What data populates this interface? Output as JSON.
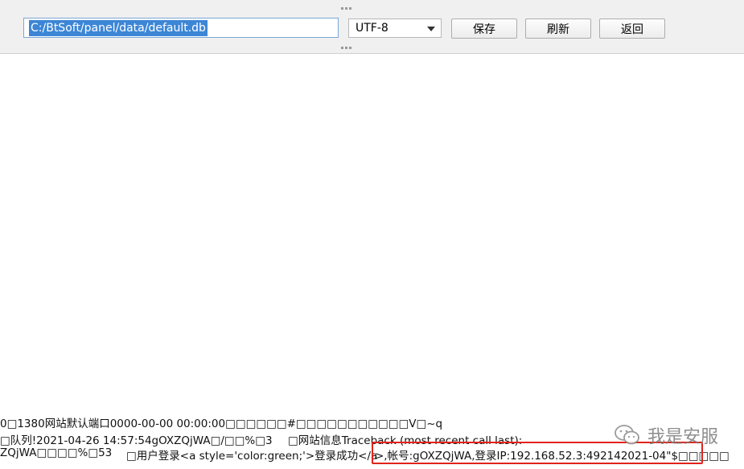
{
  "toolbar": {
    "path_value": "C:/BtSoft/panel/data/default.db",
    "encoding": "UTF-8",
    "save_label": "保存",
    "refresh_label": "刷新",
    "back_label": "返回"
  },
  "content": {
    "line1": "0□1380网站默认端口0000-00-00 00:00:00□□□□□□#□□□□□□□□□□□V□~q",
    "line2_a": "□队列!2021-04-26 14:57:54gOXZQjWA□/□□%□3",
    "line2_b": "□网站信息Traceback (most recent call last):",
    "line3_a": "ZQjWA□□□□%□53",
    "line3_b": "□用户登录<a style='color:green;'>登录成功</a",
    "line3_c": ">,帐号:gOXZQjWA,登录IP:192.168.52.3:492142021-04\"$□□□□□"
  },
  "watermark": {
    "text": "我是安服"
  },
  "colors": {
    "highlight_border": "#e2231a",
    "selection_bg": "#3d86d6",
    "toolbar_bg": "#f0f0f0"
  }
}
